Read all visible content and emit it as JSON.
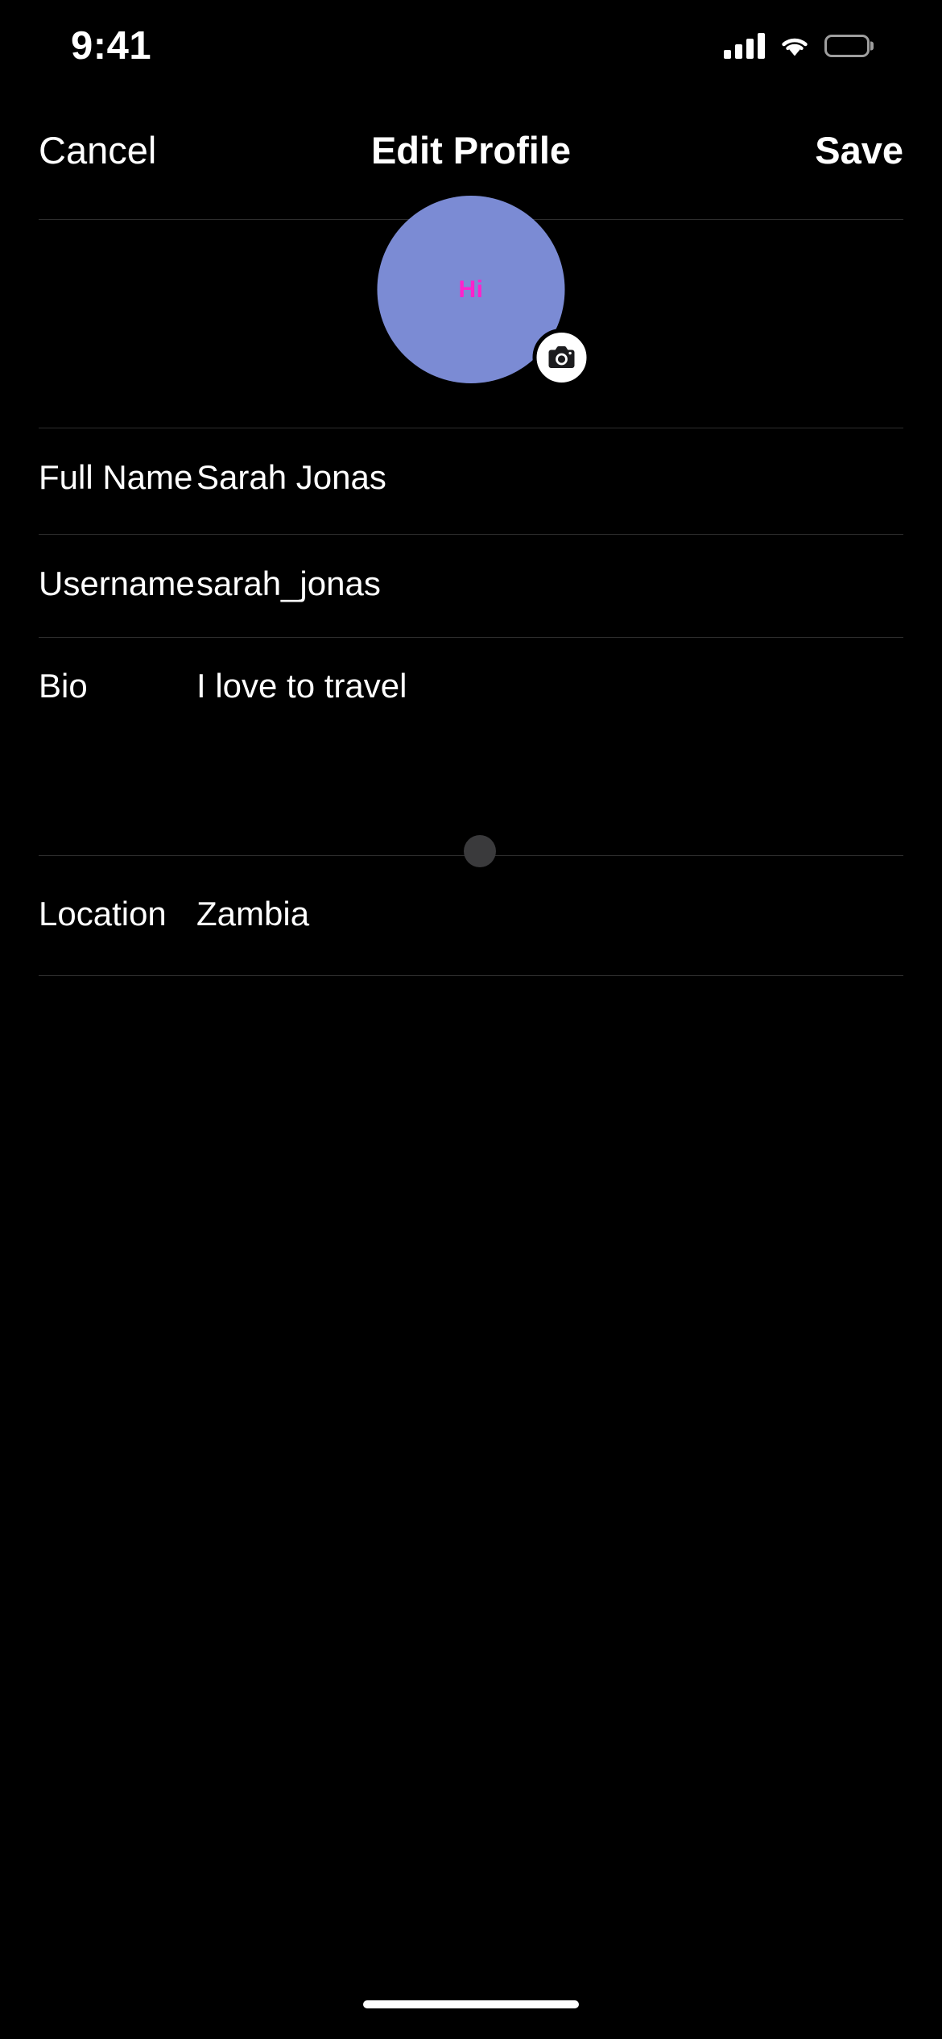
{
  "status_bar": {
    "time": "9:41",
    "icons": [
      "cellular-signal-icon",
      "wifi-icon",
      "battery-icon"
    ]
  },
  "nav_bar": {
    "cancel_label": "Cancel",
    "title": "Edit Profile",
    "save_label": "Save"
  },
  "avatar": {
    "initials": "Hi",
    "background_color": "#7b8bd4",
    "initials_color": "#ff22cc",
    "badge_icon": "camera-icon"
  },
  "form": {
    "rows": [
      {
        "label": "Full Name",
        "value": "Sarah Jonas"
      },
      {
        "label": "Username",
        "value": "sarah_jonas"
      },
      {
        "label": "Bio",
        "value": "I love to travel"
      },
      {
        "label": "Location",
        "value": "Zambia"
      }
    ]
  },
  "theme": {
    "background": "#000000",
    "text": "#ffffff",
    "divider": "rgba(255,255,255,0.18)",
    "dot": "#3a3a3c"
  }
}
